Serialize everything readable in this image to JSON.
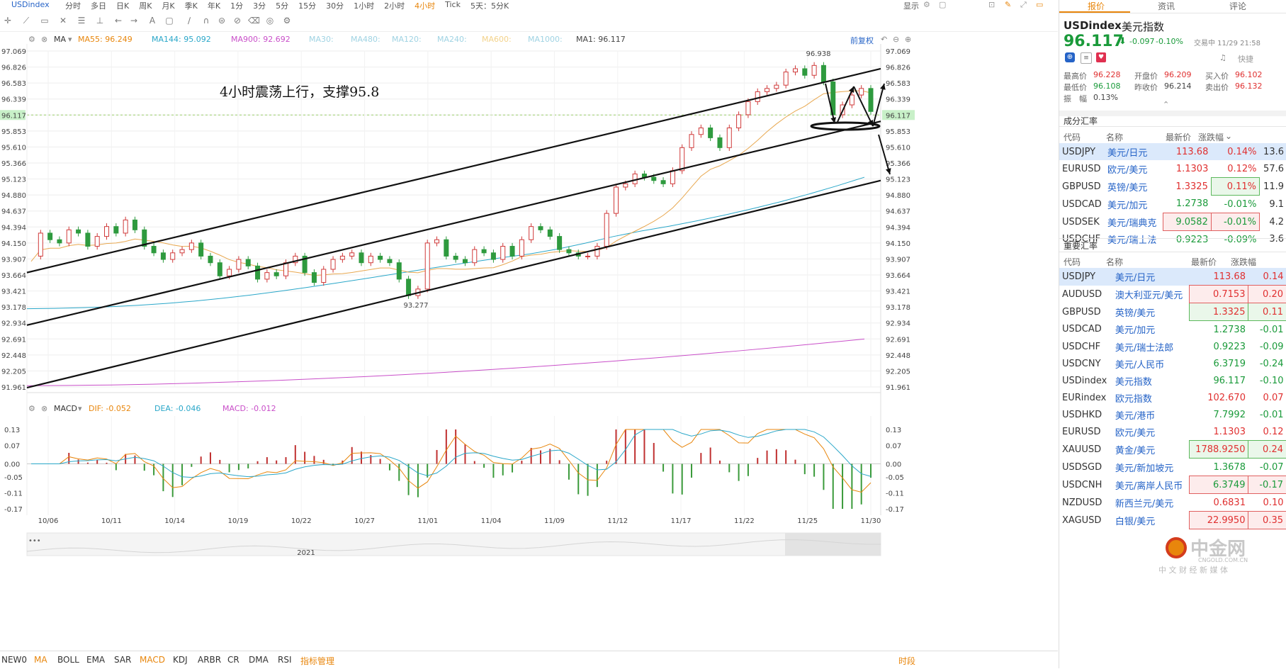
{
  "window": {
    "symbol": "USDindex",
    "periods": [
      "分时",
      "多日",
      "日K",
      "周K",
      "月K",
      "季K",
      "年K",
      "1分",
      "3分",
      "5分",
      "15分",
      "30分",
      "1小时",
      "2小时",
      "4小时",
      "Tick",
      "5天：5分K"
    ],
    "active_period": "4小时",
    "display_label": "显示"
  },
  "ma_bar": {
    "label": "MA",
    "items": [
      {
        "text": "MA55: 96.249",
        "color": "#e8860c"
      },
      {
        "text": "MA144: 95.092",
        "color": "#2aa7c9"
      },
      {
        "text": "MA900: 92.692",
        "color": "#c94fc9"
      },
      {
        "text": "MA30:",
        "color": "#9fd3e3"
      },
      {
        "text": "MA480:",
        "color": "#9fd3e3"
      },
      {
        "text": "MA120:",
        "color": "#9fd3e3"
      },
      {
        "text": "MA240:",
        "color": "#9fd3e3"
      },
      {
        "text": "MA600:",
        "color": "#f3d28a"
      },
      {
        "text": "MA1000:",
        "color": "#9fd3e3"
      },
      {
        "text": "MA1: 96.117",
        "color": "#444444"
      }
    ],
    "adjust_label": "前复权"
  },
  "macd_bar": {
    "label": "MACD",
    "dif": "DIF: -0.052",
    "dea": "DEA: -0.046",
    "macd": "MACD: -0.012"
  },
  "chart_data": {
    "type": "candlestick",
    "annotation": "4小时震荡上行，支撑95.8",
    "price_ticks": [
      "97.069",
      "96.826",
      "96.583",
      "96.339",
      "96.117",
      "95.853",
      "95.610",
      "95.366",
      "95.123",
      "94.880",
      "94.637",
      "94.394",
      "94.150",
      "93.907",
      "93.664",
      "93.421",
      "93.178",
      "92.934",
      "92.691",
      "92.448",
      "92.205",
      "91.961"
    ],
    "current_price": "96.117",
    "ylim": [
      91.961,
      97.069
    ],
    "high_label": "96.938",
    "low_label": "93.277",
    "date_ticks": [
      "10/06",
      "10/11",
      "10/14",
      "10/19",
      "10/22",
      "10/27",
      "11/01",
      "11/04",
      "11/09",
      "11/12",
      "11/17",
      "11/22",
      "11/25",
      "11/30"
    ],
    "year_label": "2021",
    "price_path": [
      93.95,
      94.3,
      94.2,
      94.15,
      94.35,
      94.3,
      94.1,
      94.25,
      94.4,
      94.3,
      94.5,
      94.35,
      94.1,
      94.0,
      93.9,
      94.0,
      94.05,
      94.15,
      93.95,
      93.85,
      93.65,
      93.75,
      93.9,
      93.8,
      93.6,
      93.7,
      93.65,
      93.85,
      93.95,
      93.7,
      93.55,
      93.75,
      93.9,
      93.95,
      94.0,
      93.85,
      93.95,
      93.9,
      93.85,
      93.6,
      93.35,
      93.45,
      94.15,
      94.2,
      93.95,
      93.9,
      93.85,
      94.05,
      94.0,
      93.9,
      94.1,
      93.95,
      94.2,
      94.4,
      94.35,
      94.25,
      94.05,
      94.0,
      93.95,
      93.95,
      94.1,
      94.6,
      95.0,
      95.05,
      95.2,
      95.15,
      95.1,
      95.05,
      95.25,
      95.6,
      95.8,
      95.9,
      95.75,
      95.6,
      95.9,
      96.1,
      96.3,
      96.45,
      96.5,
      96.55,
      96.75,
      96.8,
      96.7,
      96.85,
      96.6,
      96.1,
      96.25,
      96.4,
      96.5,
      96.15
    ],
    "channel_lines": [
      {
        "p1": [
          0,
          93.7
        ],
        "p2": [
          1,
          96.8
        ]
      },
      {
        "p1": [
          0,
          92.9
        ],
        "p2": [
          1,
          96.0
        ]
      },
      {
        "p1": [
          0,
          91.95
        ],
        "p2": [
          1,
          95.1
        ]
      }
    ],
    "ma_lines": [
      {
        "name": "MA55",
        "value": 96.249,
        "color": "#e8860c"
      },
      {
        "name": "MA144",
        "value": 95.092,
        "color": "#2aa7c9"
      },
      {
        "name": "MA900",
        "value": 92.692,
        "color": "#c94fc9"
      }
    ],
    "macd": {
      "ticks": [
        "0.13",
        "0.07",
        "0.00",
        "-0.05",
        "-0.11",
        "-0.17"
      ],
      "ylim": [
        -0.17,
        0.13
      ],
      "dif": -0.052,
      "dea": -0.046,
      "hist": -0.012
    }
  },
  "side": {
    "tabs": [
      "报价",
      "资讯",
      "评论"
    ],
    "active_tab": "报价",
    "symbol": "USDindex",
    "name": "美元指数",
    "price": "96.117",
    "change": "-0.097",
    "change_pct": "-0.10%",
    "status": "交易中 11/29 21:58",
    "quick_label": "快捷",
    "stats": {
      "high_label": "最高价",
      "high": "96.228",
      "open_label": "开盘价",
      "open": "96.209",
      "bid_label": "买入价",
      "bid": "96.102",
      "low_label": "最低价",
      "low": "96.108",
      "prev_label": "昨收价",
      "prev": "96.214",
      "ask_label": "卖出价",
      "ask": "96.132",
      "amp_label": "振　幅",
      "amp": "0.13%"
    },
    "component_title": "成分汇率",
    "component_headers": [
      "代码",
      "名称",
      "最新价",
      "涨跌幅"
    ],
    "components": [
      {
        "code": "USDJPY",
        "name": "美元/日元",
        "price": "113.68",
        "pct": "0.14%",
        "extra": "13.6"
      },
      {
        "code": "EURUSD",
        "name": "欧元/美元",
        "price": "1.1303",
        "pct": "0.12%",
        "extra": "57.6"
      },
      {
        "code": "GBPUSD",
        "name": "英镑/美元",
        "price": "1.3325",
        "pct": "0.11%",
        "extra": "11.9"
      },
      {
        "code": "USDCAD",
        "name": "美元/加元",
        "price": "1.2738",
        "pct": "-0.01%",
        "extra": "9.1"
      },
      {
        "code": "USDSEK",
        "name": "美元/瑞典克",
        "price": "9.0582",
        "pct": "-0.01%",
        "extra": "4.2"
      },
      {
        "code": "USDCHF",
        "name": "美元/瑞士法",
        "price": "0.9223",
        "pct": "-0.09%",
        "extra": "3.6"
      }
    ],
    "major_title": "重要汇率",
    "major_headers": [
      "代码",
      "名称",
      "最新价",
      "涨跌幅"
    ],
    "majors": [
      {
        "code": "USDJPY",
        "name": "美元/日元",
        "price": "113.68",
        "pct": "0.14"
      },
      {
        "code": "AUDUSD",
        "name": "澳大利亚元/美元",
        "price": "0.7153",
        "pct": "0.20"
      },
      {
        "code": "GBPUSD",
        "name": "英镑/美元",
        "price": "1.3325",
        "pct": "0.11"
      },
      {
        "code": "USDCAD",
        "name": "美元/加元",
        "price": "1.2738",
        "pct": "-0.01"
      },
      {
        "code": "USDCHF",
        "name": "美元/瑞士法郎",
        "price": "0.9223",
        "pct": "-0.09"
      },
      {
        "code": "USDCNY",
        "name": "美元/人民币",
        "price": "6.3719",
        "pct": "-0.24"
      },
      {
        "code": "USDindex",
        "name": "美元指数",
        "price": "96.117",
        "pct": "-0.10"
      },
      {
        "code": "EURindex",
        "name": "欧元指数",
        "price": "102.670",
        "pct": "0.07"
      },
      {
        "code": "USDHKD",
        "name": "美元/港币",
        "price": "7.7992",
        "pct": "-0.01"
      },
      {
        "code": "EURUSD",
        "name": "欧元/美元",
        "price": "1.1303",
        "pct": "0.12"
      },
      {
        "code": "XAUUSD",
        "name": "黄金/美元",
        "price": "1788.9250",
        "pct": "0.24"
      },
      {
        "code": "USDSGD",
        "name": "美元/新加坡元",
        "price": "1.3678",
        "pct": "-0.07"
      },
      {
        "code": "USDCNH",
        "name": "美元/离岸人民币",
        "price": "6.3749",
        "pct": "-0.17"
      },
      {
        "code": "NZDUSD",
        "name": "新西兰元/美元",
        "price": "0.6831",
        "pct": "0.10"
      },
      {
        "code": "XAGUSD",
        "name": "白银/美元",
        "price": "22.9950",
        "pct": "0.35"
      }
    ],
    "logo_text": "中金网",
    "logo_url": "CNGOLD.COM.CN",
    "logo_slogan": "中 文 财 经 新 媒 体"
  },
  "bottom": {
    "indicators": [
      "NEW0",
      "MA",
      "BOLL",
      "EMA",
      "SAR",
      "MACD",
      "KDJ",
      "ARBR",
      "CR",
      "DMA",
      "RSI",
      "指标管理"
    ],
    "active": [
      "MA",
      "MACD",
      "指标管理"
    ],
    "timezone_label": "时段"
  }
}
